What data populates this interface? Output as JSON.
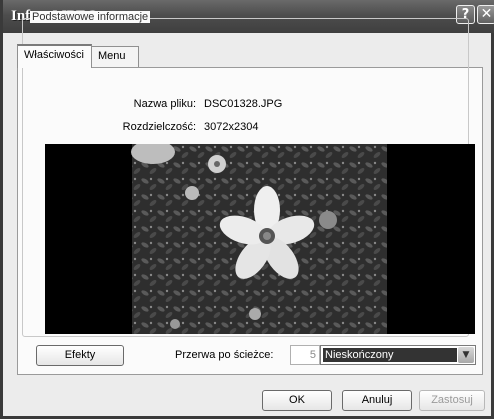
{
  "window": {
    "title": "Info o MPEG"
  },
  "tabs": [
    {
      "label": "Właściwości",
      "active": true
    },
    {
      "label": "Menu",
      "active": false
    }
  ],
  "group": {
    "label": "Podstawowe informacje"
  },
  "info": {
    "filename_label": "Nazwa pliku:",
    "filename_value": "DSC01328.JPG",
    "resolution_label": "Rozdzielczość:",
    "resolution_value": "3072x2304"
  },
  "controls": {
    "effects_label": "Efekty",
    "pause_label": "Przerwa po ścieżce:",
    "pause_value": "5",
    "pause_mode": "Nieskończony"
  },
  "footer": {
    "ok_label": "OK",
    "cancel_label": "Anuluj",
    "apply_label": "Zastosuj"
  },
  "icons": {
    "help": "help-icon",
    "close": "close-icon",
    "dropdown": "chevron-down-icon"
  }
}
